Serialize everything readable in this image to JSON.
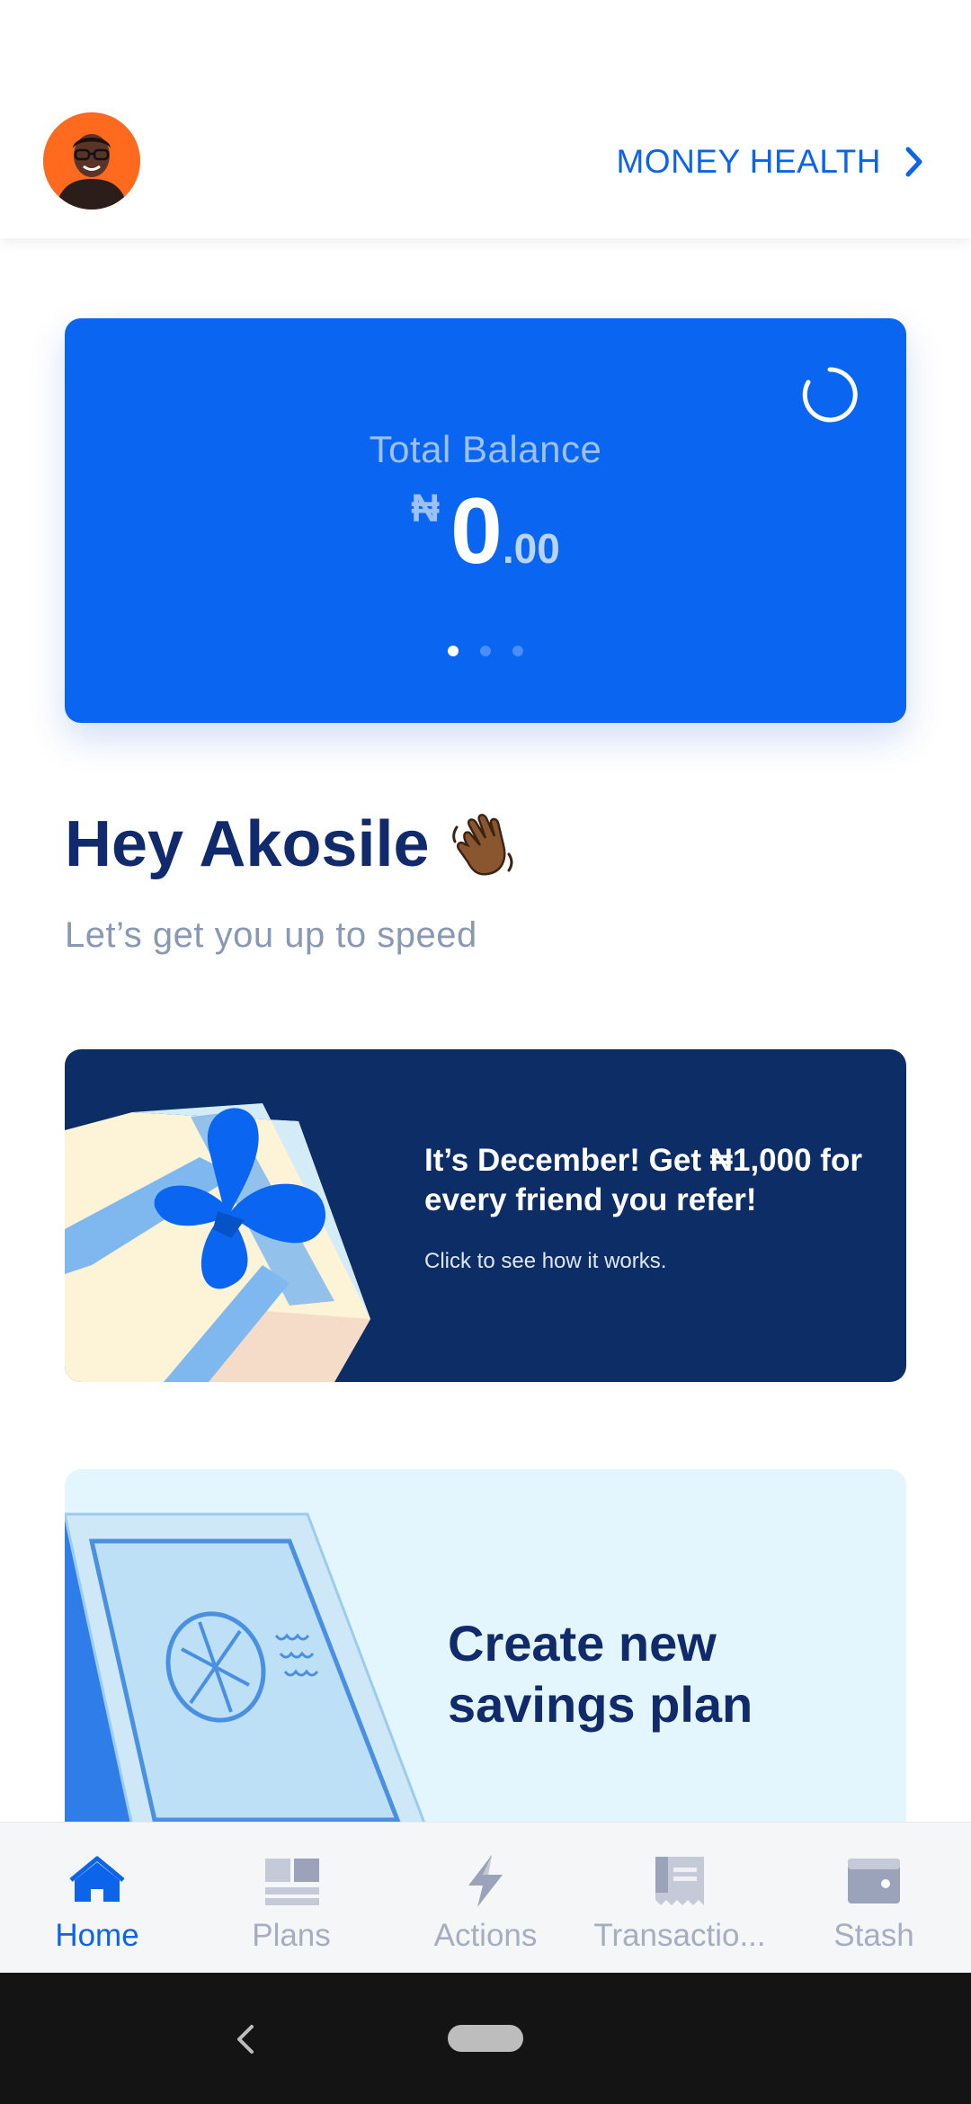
{
  "header": {
    "money_health_label": "MONEY HEALTH"
  },
  "balance_card": {
    "label": "Total Balance",
    "currency_symbol": "₦",
    "amount_whole": "0",
    "amount_decimal": ".00",
    "page_count": 3,
    "active_page": 1
  },
  "greeting": {
    "title": "Hey Akosile",
    "subtitle": "Let’s get you up to speed"
  },
  "referral_banner": {
    "title": "It’s December! Get ₦1,000 for every friend you refer!",
    "subtitle": "Click to see how it works."
  },
  "savings_card": {
    "title": "Create new savings plan"
  },
  "bottom_nav": {
    "items": [
      {
        "label": "Home",
        "icon": "home-icon",
        "active": true
      },
      {
        "label": "Plans",
        "icon": "plans-icon",
        "active": false
      },
      {
        "label": "Actions",
        "icon": "lightning-icon",
        "active": false
      },
      {
        "label": "Transactio...",
        "icon": "receipt-icon",
        "active": false
      },
      {
        "label": "Stash",
        "icon": "wallet-icon",
        "active": false
      }
    ]
  },
  "colors": {
    "primary_blue": "#0a66f0",
    "navy": "#102a6b",
    "banner_navy": "#0c2d66",
    "savings_bg": "#e3f6fd",
    "avatar_orange": "#ff6a1f"
  }
}
